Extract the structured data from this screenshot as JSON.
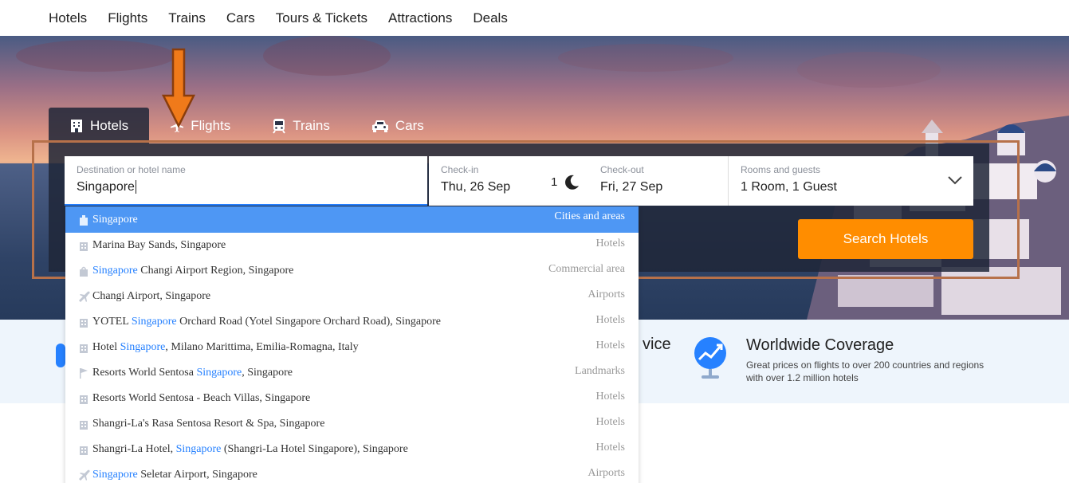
{
  "top_nav": [
    "Hotels",
    "Flights",
    "Trains",
    "Cars",
    "Tours & Tickets",
    "Attractions",
    "Deals"
  ],
  "tabs": [
    {
      "label": "Hotels",
      "icon": "hotel-icon",
      "active": true
    },
    {
      "label": "Flights",
      "icon": "plane-icon",
      "active": false
    },
    {
      "label": "Trains",
      "icon": "train-icon",
      "active": false
    },
    {
      "label": "Cars",
      "icon": "car-icon",
      "active": false
    }
  ],
  "search": {
    "destination_label": "Destination or hotel name",
    "destination_value": "Singapore",
    "checkin_label": "Check-in",
    "checkin_value": "Thu, 26 Sep",
    "nights": "1",
    "checkout_label": "Check-out",
    "checkout_value": "Fri, 27 Sep",
    "rooms_label": "Rooms and guests",
    "rooms_value": "1 Room, 1 Guest",
    "button": "Search Hotels"
  },
  "suggestions": [
    {
      "pre": "",
      "hl": "Singapore",
      "post": "",
      "category": "Cities and areas",
      "icon": "building-icon",
      "selected": true
    },
    {
      "pre": "Marina Bay Sands, Singapore",
      "hl": "",
      "post": "",
      "category": "Hotels",
      "icon": "hotel-icon"
    },
    {
      "pre": "",
      "hl": "Singapore",
      "post": " Changi Airport Region, Singapore",
      "category": "Commercial area",
      "icon": "shopping-bag-icon"
    },
    {
      "pre": "Changi Airport, Singapore",
      "hl": "",
      "post": "",
      "category": "Airports",
      "icon": "plane-icon"
    },
    {
      "pre": "YOTEL ",
      "hl": "Singapore",
      "post": " Orchard Road (Yotel Singapore Orchard Road), Singapore",
      "category": "Hotels",
      "icon": "hotel-icon"
    },
    {
      "pre": "Hotel ",
      "hl": "Singapore",
      "post": ", Milano Marittima, Emilia-Romagna, Italy",
      "category": "Hotels",
      "icon": "hotel-icon"
    },
    {
      "pre": "Resorts World Sentosa ",
      "hl": "Singapore",
      "post": ", Singapore",
      "category": "Landmarks",
      "icon": "flag-icon"
    },
    {
      "pre": "Resorts World Sentosa - Beach Villas, Singapore",
      "hl": "",
      "post": "",
      "category": "Hotels",
      "icon": "hotel-icon"
    },
    {
      "pre": "Shangri-La's Rasa Sentosa Resort & Spa, Singapore",
      "hl": "",
      "post": "",
      "category": "Hotels",
      "icon": "hotel-icon"
    },
    {
      "pre": "Shangri-La Hotel, ",
      "hl": "Singapore",
      "post": " (Shangri-La Hotel Singapore), Singapore",
      "category": "Hotels",
      "icon": "hotel-icon"
    },
    {
      "pre": "",
      "hl": "Singapore",
      "post": " Seletar Airport, Singapore",
      "category": "Airports",
      "icon": "plane-icon"
    }
  ],
  "features": {
    "partial_text": "vice",
    "worldwide_title": "Worldwide Coverage",
    "worldwide_desc": "Great prices on flights to over 200 countries and regions with over 1.2 million hotels"
  },
  "colors": {
    "accent": "#2681ff",
    "search_button": "#ff8d00",
    "annotation": "#b7714a",
    "arrow": "#f07a1a"
  }
}
